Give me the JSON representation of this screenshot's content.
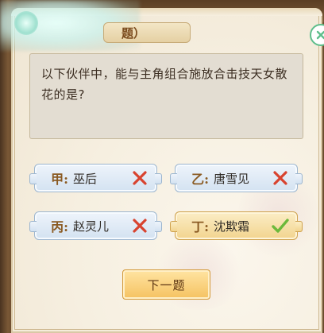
{
  "header": {
    "title": "题）"
  },
  "question": {
    "text": "以下伙伴中，能与主角组合施放合击技天女散花的是?"
  },
  "answers": [
    {
      "letter": "甲:",
      "name": "巫后",
      "result": "wrong"
    },
    {
      "letter": "乙:",
      "name": "唐雪见",
      "result": "wrong"
    },
    {
      "letter": "丙:",
      "name": "赵灵儿",
      "result": "wrong"
    },
    {
      "letter": "丁:",
      "name": "沈欺霜",
      "result": "correct"
    }
  ],
  "next_button": {
    "label": "下一题"
  },
  "colors": {
    "wrong_mark": "#d8432f",
    "correct_mark": "#6cb93b",
    "close_ring": "#5fbe8c"
  }
}
